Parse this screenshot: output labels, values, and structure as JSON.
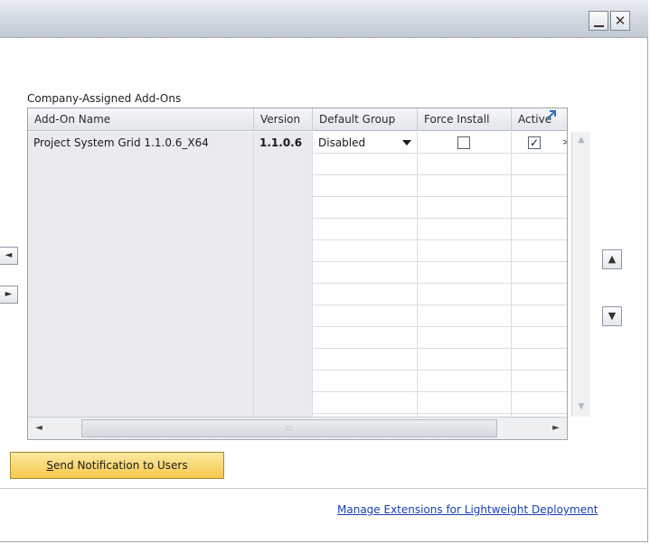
{
  "window": {
    "minimize_icon": "minimize-icon",
    "close_glyph": "✕"
  },
  "group": {
    "label": "Company-Assigned Add-Ons"
  },
  "grid": {
    "columns": [
      "Add-On Name",
      "Version",
      "Default Group",
      "Force Install",
      "Active"
    ],
    "rows": [
      {
        "name": "Project System Grid 1.1.0.6_X64",
        "version": "1.1.0.6",
        "default_group": "Disabled",
        "force_install": false,
        "active": true,
        "overflow": ">"
      }
    ],
    "empty_row_count": 13
  },
  "side_buttons": {
    "left_arrow": "◄",
    "right_arrow": "►",
    "up_arrow": "▲",
    "down_arrow": "▼"
  },
  "actions": {
    "send_notification_first": "S",
    "send_notification_rest": "end Notification to Users"
  },
  "footer": {
    "manage_link": "Manage Extensions for Lightweight Deployment"
  },
  "colors": {
    "title_bar": "#d5dbe3",
    "readonly_cell": "#e9ebee",
    "button_gold": "#f5c94c",
    "link_blue": "#1a3fb0"
  }
}
